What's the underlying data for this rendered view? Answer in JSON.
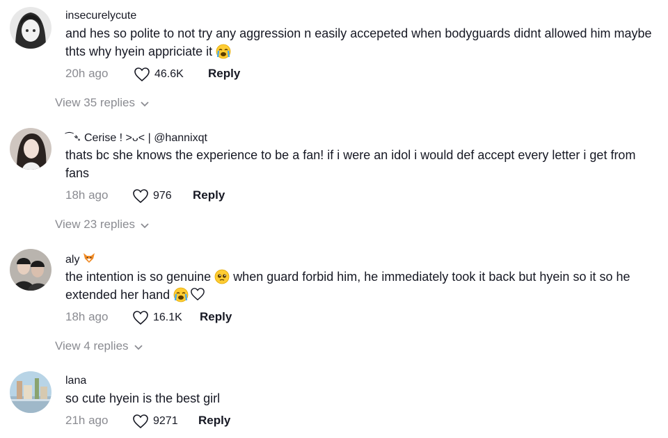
{
  "comments": [
    {
      "username": "insecurelycute",
      "text": "and hes so polite to not try any aggression n easily accepeted when bodyguards didnt allowed him maybe thts why hyein appriciate it",
      "time": "20h ago",
      "likes": "46.6K",
      "reply_label": "Reply",
      "view_replies": "View 35 replies",
      "emoji_end": "loudly-crying-face"
    },
    {
      "username_prefix": "⁀➴",
      "username": "Cerise ! >ᴗ< | @hannixqt",
      "text": "thats bc she knows the experience to be a fan! if i were an idol i would def accept every letter i get from fans",
      "time": "18h ago",
      "likes": "976",
      "reply_label": "Reply",
      "view_replies": "View 23 replies"
    },
    {
      "username": "aly",
      "username_emoji": "fox-face",
      "text_part1": "the intention is so genuine",
      "text_part2": "when guard forbid him, he immediately took it back but hyein so it so he extended her hand",
      "time": "18h ago",
      "likes": "16.1K",
      "reply_label": "Reply",
      "view_replies": "View 4 replies",
      "emojis": [
        "pleading-face",
        "loudly-crying-face",
        "white-heart"
      ]
    },
    {
      "username": "lana",
      "text": "so cute hyein is the best girl",
      "time": "21h ago",
      "likes": "9271",
      "reply_label": "Reply"
    }
  ],
  "colors": {
    "text": "#161823",
    "muted": "#8a8b91",
    "background": "#ffffff"
  }
}
